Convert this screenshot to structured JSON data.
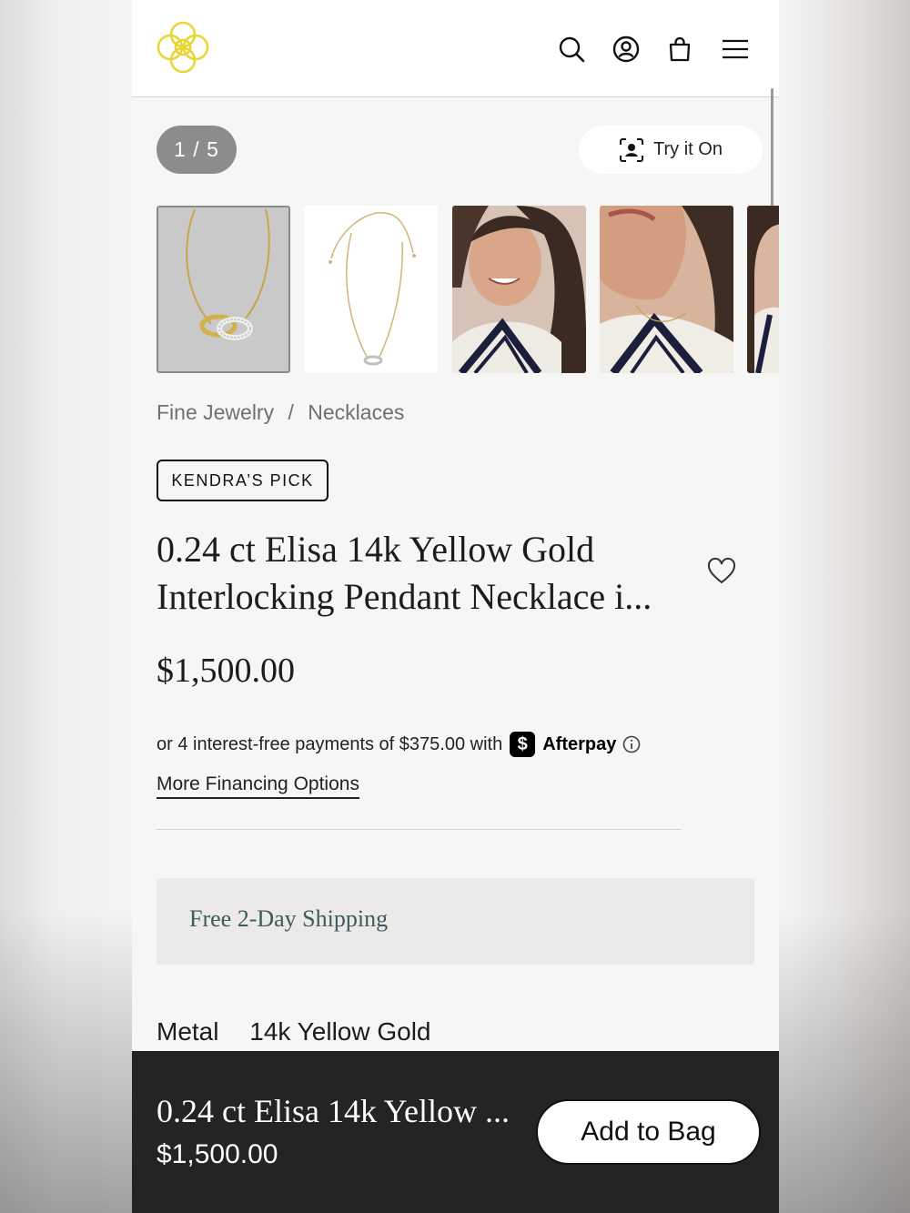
{
  "header": {
    "logo": "kendra-scott-logo",
    "icons": [
      "search-icon",
      "account-icon",
      "bag-icon",
      "menu-icon"
    ],
    "logo_color": "#e8d636"
  },
  "gallery": {
    "counter": "1 / 5",
    "try_on_label": "Try it On",
    "thumbnails": [
      "necklace-on-grey",
      "necklace-on-white",
      "model-wearing-1",
      "model-wearing-2",
      "model-wearing-3"
    ]
  },
  "breadcrumb": {
    "items": [
      "Fine Jewelry",
      "Necklaces"
    ],
    "separator": "/"
  },
  "product": {
    "badge": "KENDRA’S PICK",
    "title_line1": "0.24 ct Elisa 14k Yellow Gold",
    "title_line2": "Interlocking Pendant Necklace i...",
    "price": "$1,500.00",
    "afterpay_text": "or 4 interest-free payments of $375.00 with",
    "afterpay_brand": "Afterpay",
    "afterpay_symbol": "$",
    "financing_link": "More Financing Options",
    "shipping_text": "Free 2-Day Shipping",
    "metal_label": "Metal",
    "metal_value": "14k Yellow Gold"
  },
  "sticky_bar": {
    "title": "0.24 ct Elisa 14k Yellow ...",
    "price": "$1,500.00",
    "button_label": "Add to Bag"
  }
}
